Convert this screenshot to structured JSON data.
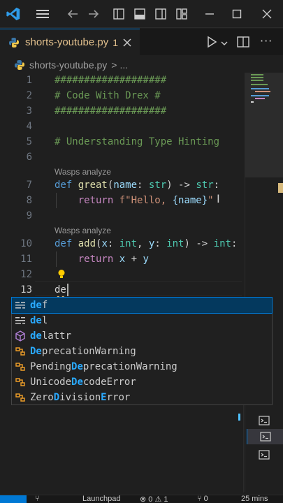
{
  "titlebar": {
    "icons": [
      "vscode-logo",
      "hamburger-menu-icon",
      "arrow-left-icon",
      "arrow-right-icon",
      "toggle-primary-sidebar-icon",
      "toggle-panel-icon",
      "toggle-secondary-sidebar-icon",
      "customize-layout-icon",
      "minimize-icon",
      "maximize-icon",
      "close-icon"
    ]
  },
  "tab": {
    "label": "shorts-youtube.py",
    "modified_count": "1",
    "close": "✕"
  },
  "editor_actions": {
    "run": "run-python-file-icon",
    "split": "split-editor-icon",
    "more": "···"
  },
  "breadcrumb": {
    "file": "shorts-youtube.py",
    "separator": ">",
    "more": "..."
  },
  "code": {
    "line_numbers": [
      "1",
      "2",
      "3",
      "4",
      "5",
      "6",
      "7",
      "8",
      "9",
      "10",
      "11",
      "12",
      "13"
    ],
    "l1": "###################",
    "l2": "# Code With Drex #",
    "l3": "###################",
    "l5": "# Understanding Type Hinting",
    "lens1": "Wasps analyze",
    "l7": {
      "def": "def ",
      "fn": "great",
      "p1": "(",
      "name": "name",
      "c1": ": ",
      "str": "str",
      "p2": ") -> ",
      "ret": "str",
      "colon": ":"
    },
    "l8": {
      "indent": "    ",
      "kw": "return ",
      "str1": "f\"Hello, ",
      "expr": "{name}",
      "str2": "\""
    },
    "lens2": "Wasps analyze",
    "l10": {
      "def": "def ",
      "fn": "add",
      "p1": "(",
      "x": "x",
      "c1": ": ",
      "t1": "int",
      "comma": ", ",
      "y": "y",
      "c2": ": ",
      "t2": "int",
      "p2": ") -> ",
      "ret": "int",
      "colon": ":"
    },
    "l11": {
      "indent": "    ",
      "kw": "return ",
      "x": "x",
      "op": " + ",
      "y": "y"
    },
    "l13": "de"
  },
  "suggestions": [
    {
      "kind": "keyword",
      "match": "de",
      "rest": "f",
      "pre": ""
    },
    {
      "kind": "keyword",
      "match": "de",
      "rest": "l",
      "pre": ""
    },
    {
      "kind": "method",
      "match": "de",
      "rest": "lattr",
      "pre": ""
    },
    {
      "kind": "class",
      "match": "De",
      "rest": "precationWarning",
      "pre": ""
    },
    {
      "kind": "class",
      "pre": "Pending",
      "match": "De",
      "rest": "precationWarning"
    },
    {
      "kind": "class",
      "pre": "Unicode",
      "match": "De",
      "rest": "codeError"
    },
    {
      "kind": "class",
      "pre": "Zero",
      "match": "D",
      "rest2": "ivision",
      "match2": "E",
      "rest": "rror"
    }
  ],
  "terminal_panel": {
    "icons": [
      "terminal-icon",
      "terminal-icon",
      "terminal-icon"
    ]
  },
  "statusbar": {
    "branch_icon": "source-control-icon",
    "launchpad": "Launchpad",
    "problems": "⊗ 0 ⚠ 1",
    "ports": "⑂ 0",
    "time": "25 mins"
  },
  "colors": {
    "accent": "#0078d4",
    "modified_tab": "#e2c08d",
    "keyword": "#569cd6",
    "function": "#dcdcaa",
    "comment": "#6a9955",
    "string": "#ce9178",
    "type": "#4ec9b0",
    "control": "#c586c0",
    "match_highlight": "#2aaaff"
  }
}
